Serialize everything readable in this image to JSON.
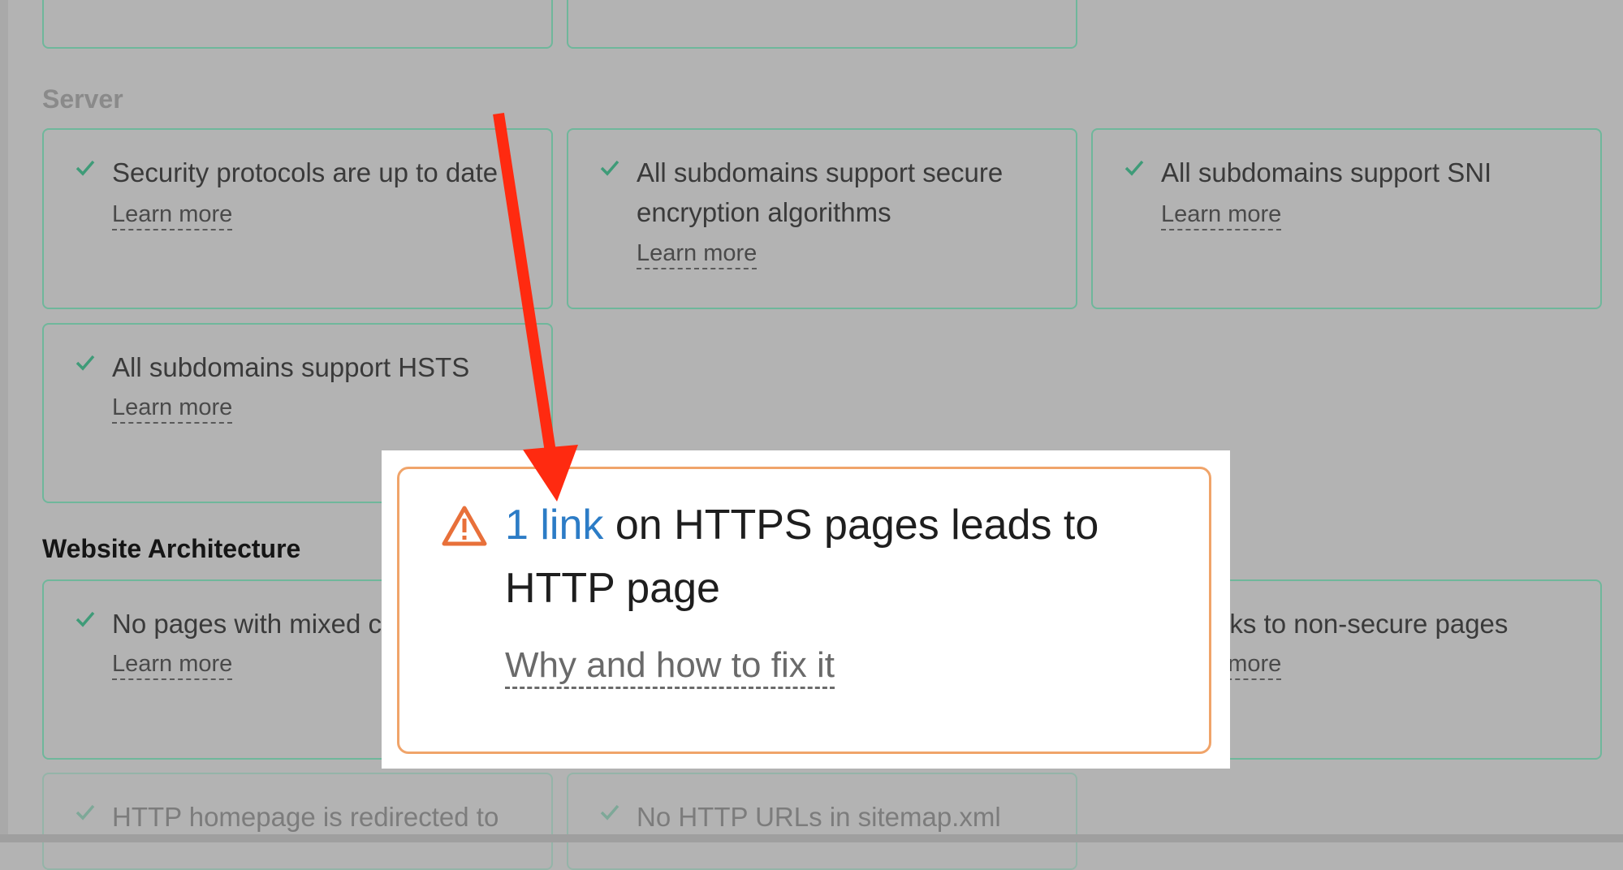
{
  "sections": {
    "server": "Server",
    "architecture": "Website Architecture"
  },
  "cards": {
    "security_protocols": {
      "text": "Security protocols are up to date",
      "learn": "Learn more"
    },
    "secure_encryption": {
      "text": "All subdomains support secure encryption algorithms",
      "learn": "Learn more"
    },
    "sni": {
      "text": "All subdomains support SNI",
      "learn": "Learn more"
    },
    "hsts": {
      "text": "All subdomains support HSTS",
      "learn": "Learn more"
    },
    "mixed_content": {
      "text": "No pages with mixed content",
      "learn": "Learn more"
    },
    "non_secure": {
      "text": "No links to non-secure pages",
      "learn": "Learn more"
    },
    "http_homepage": {
      "text": "HTTP homepage is redirected to"
    },
    "sitemap": {
      "text": "No HTTP URLs in sitemap.xml"
    }
  },
  "popup": {
    "link": "1 link",
    "text": " on HTTPS pages leads to HTTP page",
    "fix": "Why and how to fix it"
  },
  "colors": {
    "overlay": "#b3b3b3",
    "card_border": "#6fb79b",
    "check": "#3f9b78",
    "warning": "#e8703a",
    "popup_border": "#f0a46a",
    "link": "#2c7cc6",
    "arrow": "#ff2a10"
  },
  "icons": {
    "check": "check-icon",
    "warning": "warning-icon",
    "arrow": "arrow-annotation"
  }
}
